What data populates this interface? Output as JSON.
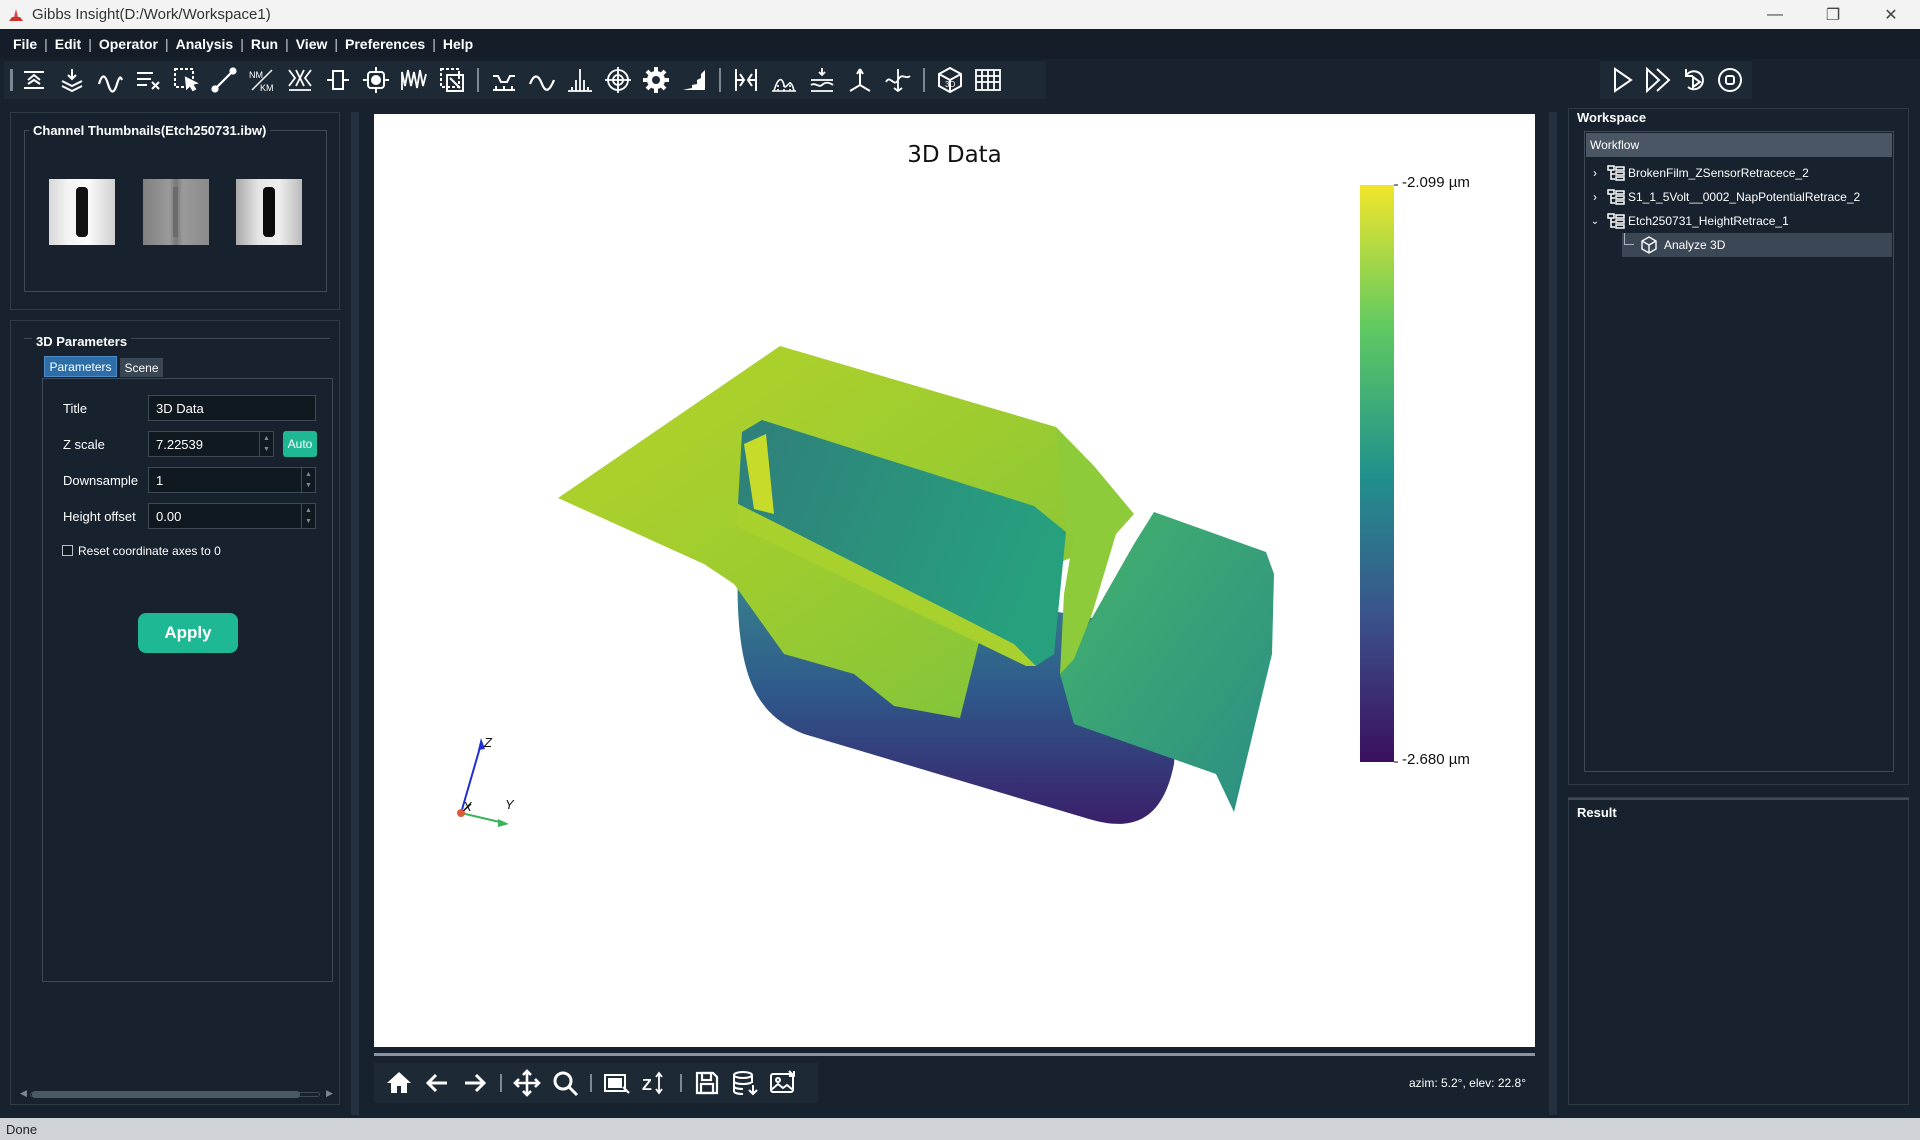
{
  "window": {
    "title": "Gibbs Insight(D:/Work/Workspace1)"
  },
  "menu": {
    "items": [
      "File",
      "Edit",
      "Operator",
      "Analysis",
      "Run",
      "View",
      "Preferences",
      "Help"
    ]
  },
  "toolbar": {
    "icons": [
      "leveling-icon",
      "flatten-icon",
      "wave-icon",
      "filter-icon",
      "select-icon",
      "line-icon",
      "unit-icon",
      "grain-icon",
      "step-icon",
      "target-icon",
      "spectrum-icon",
      "region-icon",
      "profile-icon",
      "smooth-icon",
      "peak-icon",
      "crosshair-icon",
      "gear-icon",
      "histogram-icon",
      "force-curve-icon",
      "surface-icon",
      "landscape-icon",
      "tip-icon",
      "fit-icon",
      "3d-cube-icon",
      "stack-icon"
    ],
    "run_icons": [
      "run-icon",
      "run-all-icon",
      "rerun-icon",
      "stop-icon"
    ]
  },
  "thumbnails": {
    "title": "Channel Thumbnails(Etch250731.ibw)"
  },
  "params": {
    "title": "3D Parameters",
    "tabs": [
      "Parameters",
      "Scene"
    ],
    "title_label": "Title",
    "title_value": "3D Data",
    "zscale_label": "Z scale",
    "zscale_value": "7.22539",
    "auto_label": "Auto",
    "downsample_label": "Downsample",
    "downsample_value": "1",
    "offset_label": "Height offset",
    "offset_value": "0.00",
    "reset_label": "Reset coordinate axes to 0",
    "apply_label": "Apply"
  },
  "plot": {
    "title": "3D Data",
    "colorbar_max": "-2.099 µm",
    "colorbar_min": "-2.680 µm",
    "axis_x": "X",
    "axis_y": "Y",
    "axis_z": "Z",
    "view_readout": "azim: 5.2°, elev: 22.8°"
  },
  "workspace": {
    "title": "Workspace",
    "header": "Workflow",
    "items": [
      "BrokenFilm_ZSensorRetracece_2",
      "S1_1_5Volt__0002_NapPotentialRetrace_2",
      "Etch250731_HeightRetrace_1"
    ],
    "child": "Analyze 3D"
  },
  "result": {
    "title": "Result"
  },
  "status": {
    "text": "Done"
  },
  "colors": {
    "accent": "#1fb894",
    "background": "#17222e",
    "surface_high": "#f2e62a",
    "surface_low": "#3b0f5e"
  }
}
